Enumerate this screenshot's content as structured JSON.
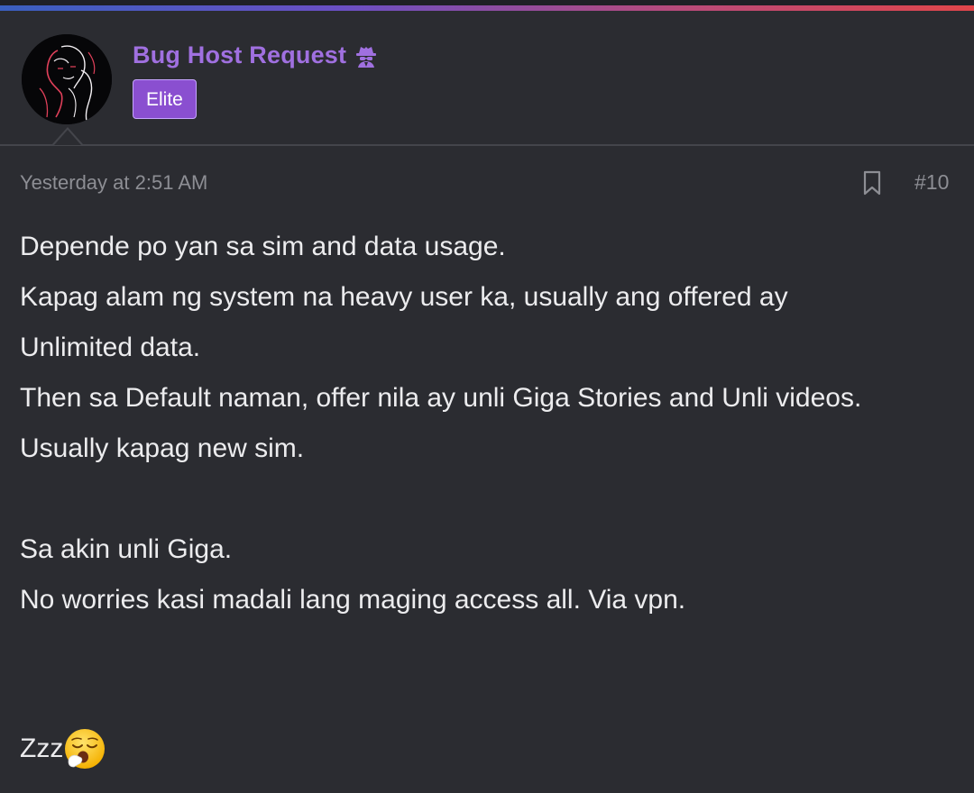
{
  "post": {
    "author": {
      "name": "Bug Host Request",
      "name_icon": "spy-icon",
      "role_badge": "Elite",
      "avatar_icon": "avatar-line-art"
    },
    "timestamp": "Yesterday at 2:51 AM",
    "bookmark_icon": "bookmark-icon",
    "post_number": "#10",
    "body_lines": [
      "Depende po yan sa sim and data usage.",
      "Kapag alam ng system na heavy user ka, usually ang offered ay",
      "Unlimited data.",
      "Then sa Default naman, offer nila ay unli Giga Stories and Unli videos.",
      "Usually kapag new sim.",
      "",
      "Sa akin unli Giga.",
      "No worries kasi madali lang maging access all. Via vpn."
    ],
    "signoff": "Zzz",
    "signoff_emoji": "yawning-face-emoji"
  },
  "colors": {
    "background": "#2b2c31",
    "username": "#a070e0",
    "badge_bg": "#8a4fd0",
    "body_text": "#ececee",
    "meta_text": "#8d8e94"
  }
}
